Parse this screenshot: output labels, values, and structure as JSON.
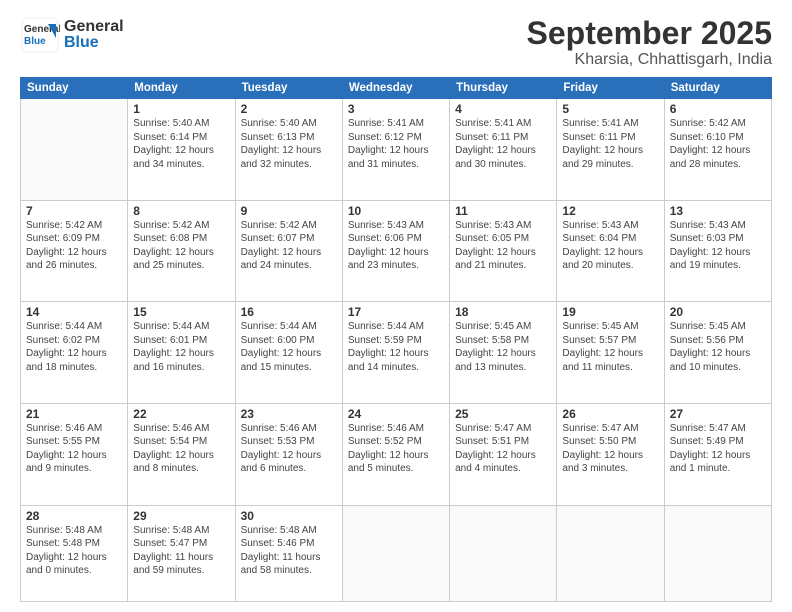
{
  "header": {
    "logo": {
      "general": "General",
      "blue": "Blue"
    },
    "title": "September 2025",
    "location": "Kharsia, Chhattisgarh, India"
  },
  "calendar": {
    "days_of_week": [
      "Sunday",
      "Monday",
      "Tuesday",
      "Wednesday",
      "Thursday",
      "Friday",
      "Saturday"
    ],
    "weeks": [
      [
        {
          "day": "",
          "info": ""
        },
        {
          "day": "1",
          "info": "Sunrise: 5:40 AM\nSunset: 6:14 PM\nDaylight: 12 hours\nand 34 minutes."
        },
        {
          "day": "2",
          "info": "Sunrise: 5:40 AM\nSunset: 6:13 PM\nDaylight: 12 hours\nand 32 minutes."
        },
        {
          "day": "3",
          "info": "Sunrise: 5:41 AM\nSunset: 6:12 PM\nDaylight: 12 hours\nand 31 minutes."
        },
        {
          "day": "4",
          "info": "Sunrise: 5:41 AM\nSunset: 6:11 PM\nDaylight: 12 hours\nand 30 minutes."
        },
        {
          "day": "5",
          "info": "Sunrise: 5:41 AM\nSunset: 6:11 PM\nDaylight: 12 hours\nand 29 minutes."
        },
        {
          "day": "6",
          "info": "Sunrise: 5:42 AM\nSunset: 6:10 PM\nDaylight: 12 hours\nand 28 minutes."
        }
      ],
      [
        {
          "day": "7",
          "info": "Sunrise: 5:42 AM\nSunset: 6:09 PM\nDaylight: 12 hours\nand 26 minutes."
        },
        {
          "day": "8",
          "info": "Sunrise: 5:42 AM\nSunset: 6:08 PM\nDaylight: 12 hours\nand 25 minutes."
        },
        {
          "day": "9",
          "info": "Sunrise: 5:42 AM\nSunset: 6:07 PM\nDaylight: 12 hours\nand 24 minutes."
        },
        {
          "day": "10",
          "info": "Sunrise: 5:43 AM\nSunset: 6:06 PM\nDaylight: 12 hours\nand 23 minutes."
        },
        {
          "day": "11",
          "info": "Sunrise: 5:43 AM\nSunset: 6:05 PM\nDaylight: 12 hours\nand 21 minutes."
        },
        {
          "day": "12",
          "info": "Sunrise: 5:43 AM\nSunset: 6:04 PM\nDaylight: 12 hours\nand 20 minutes."
        },
        {
          "day": "13",
          "info": "Sunrise: 5:43 AM\nSunset: 6:03 PM\nDaylight: 12 hours\nand 19 minutes."
        }
      ],
      [
        {
          "day": "14",
          "info": "Sunrise: 5:44 AM\nSunset: 6:02 PM\nDaylight: 12 hours\nand 18 minutes."
        },
        {
          "day": "15",
          "info": "Sunrise: 5:44 AM\nSunset: 6:01 PM\nDaylight: 12 hours\nand 16 minutes."
        },
        {
          "day": "16",
          "info": "Sunrise: 5:44 AM\nSunset: 6:00 PM\nDaylight: 12 hours\nand 15 minutes."
        },
        {
          "day": "17",
          "info": "Sunrise: 5:44 AM\nSunset: 5:59 PM\nDaylight: 12 hours\nand 14 minutes."
        },
        {
          "day": "18",
          "info": "Sunrise: 5:45 AM\nSunset: 5:58 PM\nDaylight: 12 hours\nand 13 minutes."
        },
        {
          "day": "19",
          "info": "Sunrise: 5:45 AM\nSunset: 5:57 PM\nDaylight: 12 hours\nand 11 minutes."
        },
        {
          "day": "20",
          "info": "Sunrise: 5:45 AM\nSunset: 5:56 PM\nDaylight: 12 hours\nand 10 minutes."
        }
      ],
      [
        {
          "day": "21",
          "info": "Sunrise: 5:46 AM\nSunset: 5:55 PM\nDaylight: 12 hours\nand 9 minutes."
        },
        {
          "day": "22",
          "info": "Sunrise: 5:46 AM\nSunset: 5:54 PM\nDaylight: 12 hours\nand 8 minutes."
        },
        {
          "day": "23",
          "info": "Sunrise: 5:46 AM\nSunset: 5:53 PM\nDaylight: 12 hours\nand 6 minutes."
        },
        {
          "day": "24",
          "info": "Sunrise: 5:46 AM\nSunset: 5:52 PM\nDaylight: 12 hours\nand 5 minutes."
        },
        {
          "day": "25",
          "info": "Sunrise: 5:47 AM\nSunset: 5:51 PM\nDaylight: 12 hours\nand 4 minutes."
        },
        {
          "day": "26",
          "info": "Sunrise: 5:47 AM\nSunset: 5:50 PM\nDaylight: 12 hours\nand 3 minutes."
        },
        {
          "day": "27",
          "info": "Sunrise: 5:47 AM\nSunset: 5:49 PM\nDaylight: 12 hours\nand 1 minute."
        }
      ],
      [
        {
          "day": "28",
          "info": "Sunrise: 5:48 AM\nSunset: 5:48 PM\nDaylight: 12 hours\nand 0 minutes."
        },
        {
          "day": "29",
          "info": "Sunrise: 5:48 AM\nSunset: 5:47 PM\nDaylight: 11 hours\nand 59 minutes."
        },
        {
          "day": "30",
          "info": "Sunrise: 5:48 AM\nSunset: 5:46 PM\nDaylight: 11 hours\nand 58 minutes."
        },
        {
          "day": "",
          "info": ""
        },
        {
          "day": "",
          "info": ""
        },
        {
          "day": "",
          "info": ""
        },
        {
          "day": "",
          "info": ""
        }
      ]
    ]
  }
}
